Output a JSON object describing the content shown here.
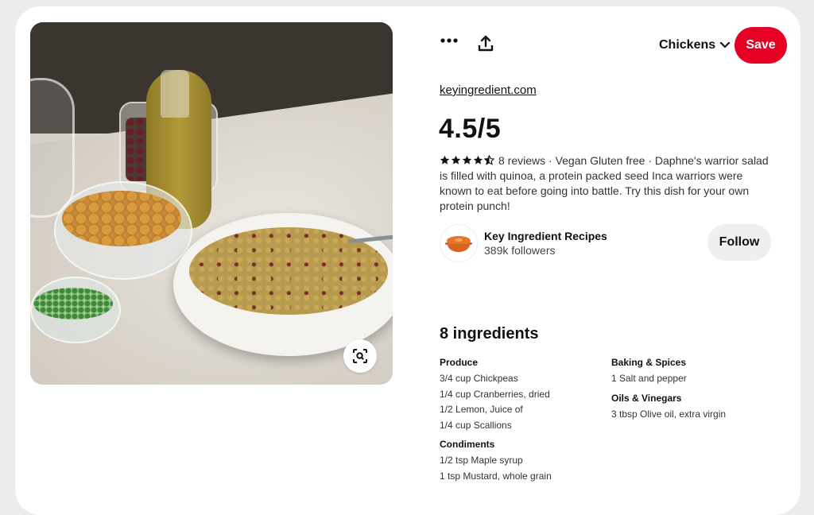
{
  "header": {
    "board_name": "Chickens",
    "save_label": "Save",
    "more_icon": "more-horizontal-icon",
    "share_icon": "share-upload-icon"
  },
  "pin": {
    "source": "keyingredient.com",
    "rating": "4.5/5",
    "stars": 4.5,
    "reviews": "8 reviews",
    "description": " · Vegan Gluten free · Daphne's warrior salad is filled with quinoa, a protein packed seed Inca warriors were known to eat before going into battle. Try this dish for your own protein punch!"
  },
  "creator": {
    "name": "Key Ingredient Recipes",
    "followers": "389k followers",
    "follow_label": "Follow"
  },
  "ingredients": {
    "title": "8 ingredients",
    "left": [
      {
        "group": "Produce",
        "items": [
          "3/4 cup Chickpeas",
          "1/4 cup Cranberries, dried",
          "1/2 Lemon, Juice of",
          "1/4 cup Scallions"
        ]
      },
      {
        "group": "Condiments",
        "items": [
          "1/2 tsp Maple syrup",
          "1 tsp Mustard, whole grain"
        ]
      }
    ],
    "right": [
      {
        "group": "Baking & Spices",
        "items": [
          "1 Salt and pepper"
        ]
      },
      {
        "group": "Oils & Vinegars",
        "items": [
          "3 tbsp Olive oil, extra virgin"
        ]
      }
    ]
  },
  "colors": {
    "save": "#e60023",
    "follow_bg": "#efefef",
    "creator_orange": "#e8742a"
  }
}
